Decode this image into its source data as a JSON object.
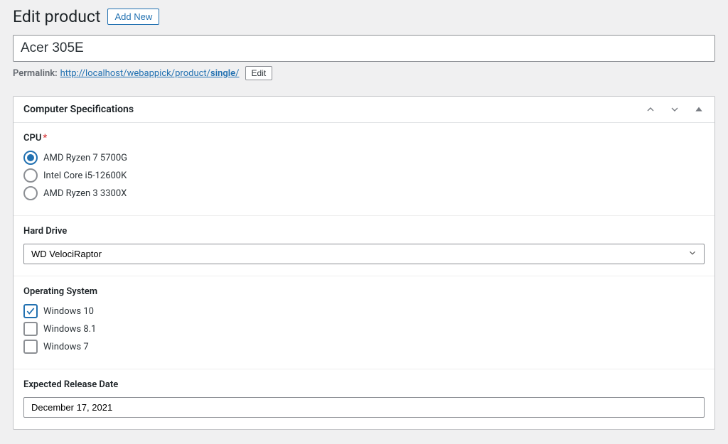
{
  "header": {
    "page_title": "Edit product",
    "add_new_label": "Add New"
  },
  "title_input": {
    "value": "Acer 305E"
  },
  "permalink": {
    "label": "Permalink:",
    "url_prefix": "http://localhost/webappick/product/",
    "slug": "single",
    "url_suffix": "/",
    "edit_label": "Edit"
  },
  "metabox": {
    "title": "Computer Specifications",
    "fields": {
      "cpu": {
        "label": "CPU",
        "required": true,
        "options": [
          {
            "label": "AMD Ryzen 7 5700G",
            "selected": true
          },
          {
            "label": "Intel Core i5-12600K",
            "selected": false
          },
          {
            "label": "AMD Ryzen 3 3300X",
            "selected": false
          }
        ]
      },
      "hard_drive": {
        "label": "Hard Drive",
        "value": "WD VelociRaptor"
      },
      "os": {
        "label": "Operating System",
        "options": [
          {
            "label": "Windows 10",
            "checked": true
          },
          {
            "label": "Windows 8.1",
            "checked": false
          },
          {
            "label": "Windows 7",
            "checked": false
          }
        ]
      },
      "release_date": {
        "label": "Expected Release Date",
        "value": "December 17, 2021"
      }
    }
  }
}
